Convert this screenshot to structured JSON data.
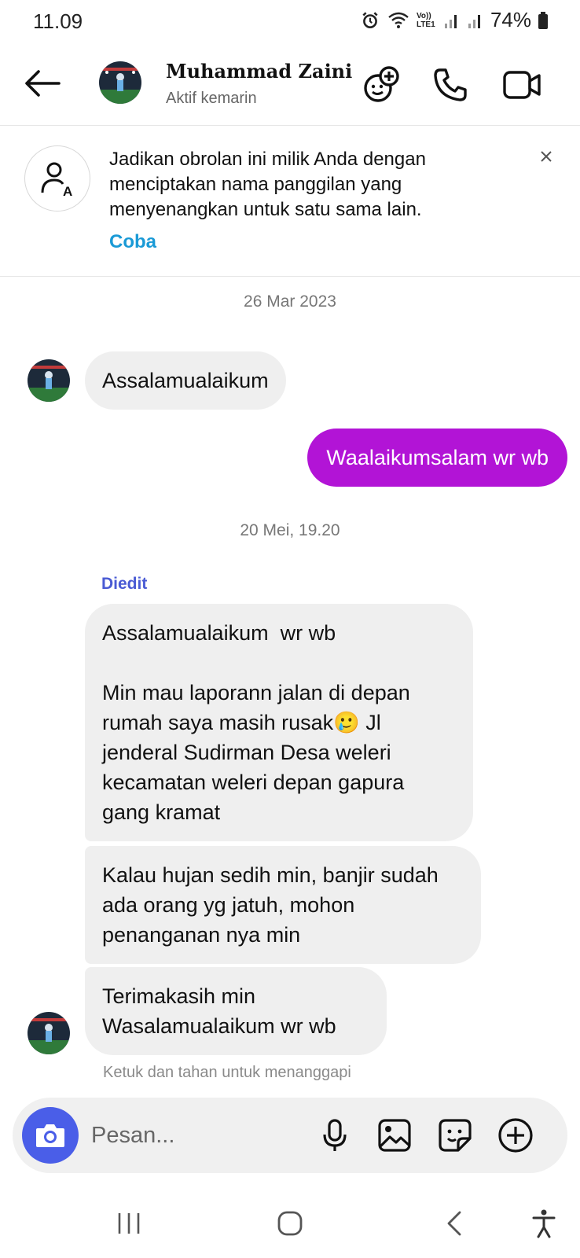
{
  "status_bar": {
    "time": "11.09",
    "network_label": "Vo)) LTE1",
    "battery": "74%"
  },
  "header": {
    "back_icon": "arrow-left-icon",
    "contact_name": "Muhammad Zaini",
    "contact_status": "Aktif kemarin",
    "icons": [
      "add-friends-icon",
      "phone-icon",
      "video-call-icon"
    ]
  },
  "nickname_banner": {
    "text": "Jadikan obrolan ini milik Anda dengan menciptakan nama panggilan yang menyenangkan untuk satu sama lain.",
    "action": "Coba",
    "close_label": "×"
  },
  "chat": {
    "date_1": "26 Mar 2023",
    "msg_in_1": "Assalamualaikum",
    "msg_out_1": "Waalaikumsalam wr wb",
    "date_2": "20 Mei, 19.20",
    "edited_label": "Diedit",
    "msg_in_2": "Assalamualaikum  wr wb\n\nMin mau laporann jalan di depan rumah saya masih rusak🥲 Jl jenderal Sudirman Desa weleri kecamatan weleri depan gapura gang kramat",
    "msg_in_3": "Kalau hujan sedih min, banjir sudah ada orang yg jatuh, mohon penanganan nya min",
    "msg_in_4": "Terimakasih min\nWasalamualaikum wr wb",
    "hint": "Ketuk dan tahan untuk menanggapi"
  },
  "composer": {
    "placeholder": "Pesan...",
    "icons": [
      "camera-icon",
      "microphone-icon",
      "gallery-icon",
      "sticker-icon",
      "plus-icon"
    ]
  },
  "colors": {
    "outgoing_bubble": "#b214d6",
    "incoming_bubble": "#efefef",
    "link": "#1a9ad6",
    "edited": "#4a5bd4",
    "camera_button": "#4a5ee8"
  }
}
